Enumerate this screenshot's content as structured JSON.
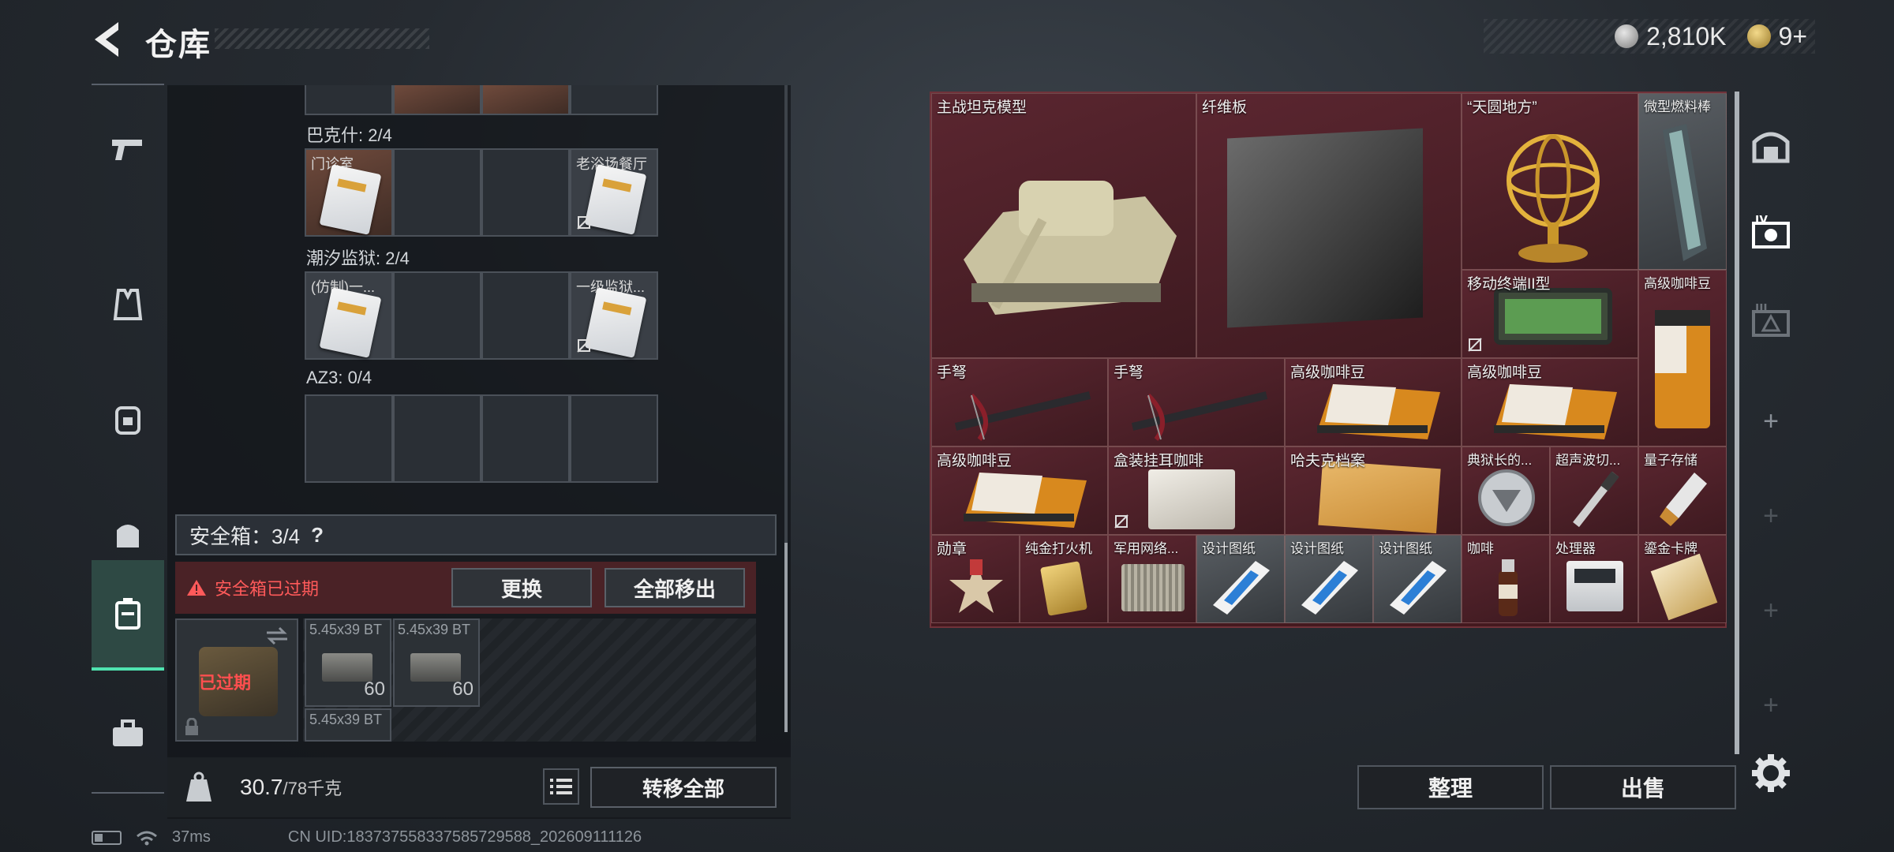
{
  "header": {
    "title": "仓库",
    "currency_silver": "2,810K",
    "currency_gold": "9+"
  },
  "left_panel": {
    "rows": [
      {
        "title": "巴克什: 2/4",
        "cells": [
          {
            "label": "门诊室"
          },
          {
            "label": ""
          },
          {
            "label": ""
          },
          {
            "label": "老浴场餐厅"
          }
        ]
      },
      {
        "title": "潮汐监狱: 2/4",
        "cells": [
          {
            "label": "(仿制)一..."
          },
          {
            "label": ""
          },
          {
            "label": ""
          },
          {
            "label": "一级监狱..."
          }
        ]
      },
      {
        "title": "AZ3: 0/4",
        "cells": [
          {
            "label": ""
          },
          {
            "label": ""
          },
          {
            "label": ""
          },
          {
            "label": ""
          }
        ]
      }
    ],
    "safe_box": {
      "label": "安全箱：3/4",
      "help": "?"
    },
    "expired": {
      "message": "安全箱已过期",
      "replace_label": "更换",
      "move_all_out_label": "全部移出",
      "badge": "已过期"
    },
    "ammo": [
      {
        "label": "5.45x39 BT",
        "count": "60"
      },
      {
        "label": "5.45x39 BT",
        "count": "60"
      },
      {
        "label": "5.45x39 BT",
        "count": ""
      }
    ],
    "weight": {
      "current": "30.7",
      "max": "/78千克"
    },
    "transfer_all_label": "转移全部"
  },
  "right_panel": {
    "items": [
      {
        "label": "主战坦克模型"
      },
      {
        "label": "纤维板"
      },
      {
        "label": "“天圆地方”"
      },
      {
        "label": "微型燃料棒"
      },
      {
        "label": "移动终端II型"
      },
      {
        "label": "高级咖啡豆"
      },
      {
        "label": "手弩"
      },
      {
        "label": "手弩"
      },
      {
        "label": "高级咖啡豆"
      },
      {
        "label": "高级咖啡豆"
      },
      {
        "label": "高级咖啡豆"
      },
      {
        "label": "盒装挂耳咖啡"
      },
      {
        "label": "哈夫克档案"
      },
      {
        "label": "典狱长的..."
      },
      {
        "label": "超声波切..."
      },
      {
        "label": "量子存储"
      },
      {
        "label": "勋章"
      },
      {
        "label": "纯金打火机"
      },
      {
        "label": "军用网络..."
      },
      {
        "label": "设计图纸"
      },
      {
        "label": "设计图纸"
      },
      {
        "label": "设计图纸"
      },
      {
        "label": "咖啡"
      },
      {
        "label": "处理器"
      },
      {
        "label": "鎏金卡牌"
      }
    ],
    "sort_label": "整理",
    "sell_label": "出售"
  },
  "status_bar": {
    "ping": "37ms",
    "uid": "CN UID:183737558337585729588_202609111126"
  },
  "colors": {
    "accent_active": "#4fe3b0",
    "expired_red": "#ff5a5a",
    "grid_maroon": "#44191f"
  }
}
